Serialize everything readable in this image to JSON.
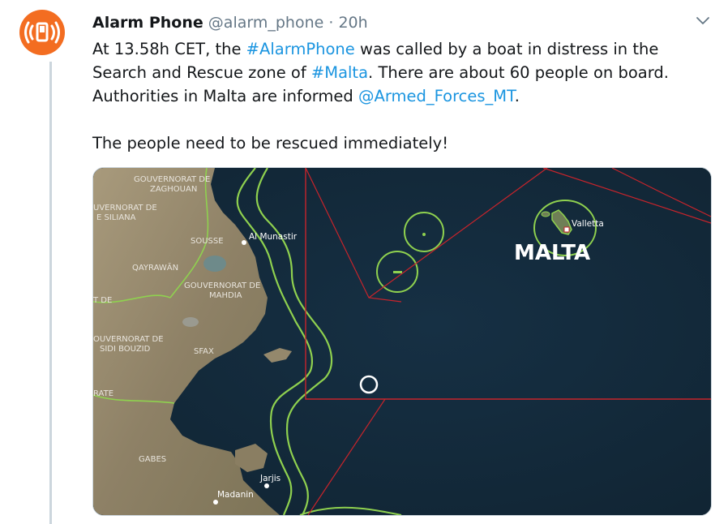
{
  "author": {
    "display_name": "Alarm Phone",
    "handle": "@alarm_phone",
    "separator": "·",
    "time": "20h"
  },
  "body": {
    "p1_a": "At 13.58h CET, the ",
    "p1_hashtag1": "#AlarmPhone",
    "p1_b": " was called by a boat in distress in the Search and Rescue zone of ",
    "p1_hashtag2": "#Malta",
    "p1_c": ". There are about 60 people on board. Authorities in Malta are informed ",
    "p1_mention": "@Armed_Forces_MT",
    "p1_d": ".",
    "p2": "The people need to be rescued immediately!"
  },
  "map": {
    "country_label": "MALTA",
    "labels": {
      "gov_zaghouan_1": "GOUVERNORAT DE",
      "gov_zaghouan_2": "ZAGHOUAN",
      "gov_siliana_1": "UVERNORAT DE",
      "gov_siliana_2": "E SILIANA",
      "sousse": "SOUSSE",
      "al_munastir": "Al Munastir",
      "qayrawan": "QAYRAWĀN",
      "gov_mahdia_1": "GOUVERNORAT DE",
      "gov_mahdia_2": "MAHDIA",
      "t_de": "T DE",
      "gov_sidibouzid_1": "OUVERNORAT DE",
      "gov_sidibouzid_2": "SIDI BOUZID",
      "sfax": "SFAX",
      "rate": "RATE",
      "gabes": "GABES",
      "jarjis": "Jarjis",
      "madanin": "Madanin",
      "valletta": "Valletta"
    }
  },
  "colors": {
    "avatar_orange": "#f36d21",
    "link_blue": "#1b95e0",
    "sea": "#142634",
    "boundary_green": "#8fd14f",
    "sar_red": "#c8242b"
  },
  "icons": {
    "avatar": "alarm-phone-logo",
    "caret": "chevron-down-icon",
    "boat_marker": "position-circle-icon"
  }
}
